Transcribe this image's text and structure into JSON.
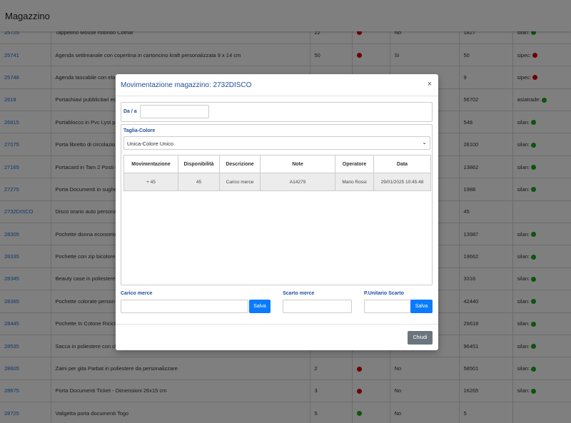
{
  "app": {
    "title": "Magazzino"
  },
  "background_rows": [
    {
      "code": "25725",
      "desc": "Tappetino Mouse rotondo Cotnar",
      "qty": "22",
      "dot": "red",
      "flag": "No",
      "stock": "1827",
      "supplier": "silan:",
      "sdot": "green"
    },
    {
      "code": "25741",
      "desc": "Agenda settimanale con copertina in cartoncino kraft personalizzata 9 x 14 cm",
      "qty": "50",
      "dot": "red",
      "flag": "Si",
      "stock": "50",
      "supplier": "sipec:",
      "sdot": "red"
    },
    {
      "code": "25748",
      "desc": "Agenda tascabile con ela",
      "qty": "",
      "dot": "",
      "flag": "",
      "stock": "9",
      "supplier": "sipec:",
      "sdot": "red"
    },
    {
      "code": "2618",
      "desc": "Portachiavi pubblicitari ec",
      "qty": "",
      "dot": "",
      "flag": "",
      "stock": "56702",
      "supplier": "asiatrade:",
      "sdot": "green"
    },
    {
      "code": "26615",
      "desc": "Portablocco in Pvc Lyst pe",
      "qty": "",
      "dot": "",
      "flag": "",
      "stock": "548",
      "supplier": "silan:",
      "sdot": "green"
    },
    {
      "code": "27075",
      "desc": "Porta libretto di circolazio",
      "qty": "",
      "dot": "",
      "flag": "",
      "stock": "28100",
      "supplier": "silan:",
      "sdot": "green"
    },
    {
      "code": "27165",
      "desc": "Portacard in Tam 2 Posti B",
      "qty": "",
      "dot": "",
      "flag": "",
      "stock": "13862",
      "supplier": "silan:",
      "sdot": "green"
    },
    {
      "code": "27275",
      "desc": "Porta Documenti in sughe",
      "qty": "",
      "dot": "",
      "flag": "",
      "stock": "1988",
      "supplier": "silan:",
      "sdot": "green"
    },
    {
      "code": "2732DISCO",
      "desc": "Disco orario auto persona",
      "qty": "",
      "dot": "",
      "flag": "",
      "stock": "45",
      "supplier": "",
      "sdot": ""
    },
    {
      "code": "28305",
      "desc": "Pochette donna economic",
      "qty": "",
      "dot": "",
      "flag": "",
      "stock": "13987",
      "supplier": "silan:",
      "sdot": "green"
    },
    {
      "code": "28335",
      "desc": "Pochette con zip bicolore",
      "qty": "",
      "dot": "",
      "flag": "",
      "stock": "19662",
      "supplier": "silan:",
      "sdot": "green"
    },
    {
      "code": "28345",
      "desc": "Beauty case in poliestere",
      "qty": "",
      "dot": "",
      "flag": "",
      "stock": "3316",
      "supplier": "silan:",
      "sdot": "green"
    },
    {
      "code": "28365",
      "desc": "Pochette colorate person",
      "qty": "",
      "dot": "",
      "flag": "",
      "stock": "42440",
      "supplier": "silan:",
      "sdot": "green"
    },
    {
      "code": "28445",
      "desc": "Pochette In Cotone Ricicl",
      "qty": "",
      "dot": "",
      "flag": "",
      "stock": "26618",
      "supplier": "silan:",
      "sdot": "green"
    },
    {
      "code": "28535",
      "desc": "Sacca in poliestere con ch",
      "qty": "",
      "dot": "",
      "flag": "",
      "stock": "96451",
      "supplier": "silan:",
      "sdot": "green"
    },
    {
      "code": "28605",
      "desc": "Zaini per gita Parbat in poliestere da personalizzare",
      "qty": "2",
      "dot": "red",
      "flag": "No",
      "stock": "58501",
      "supplier": "silan:",
      "sdot": "green"
    },
    {
      "code": "28675",
      "desc": "Porta Documenti Ticket - Dimensioni 26x15 cm",
      "qty": "3",
      "dot": "red",
      "flag": "No",
      "stock": "16265",
      "supplier": "silan:",
      "sdot": "green"
    },
    {
      "code": "28725",
      "desc": "Valigetta porta documenti Togo",
      "qty": "5",
      "dot": "green",
      "flag": "No",
      "stock": "5",
      "supplier": "",
      "sdot": ""
    }
  ],
  "modal": {
    "title": "Movimentazione magazzino: 2732DISCO",
    "close_glyph": "×",
    "da_a_label": "Da / a",
    "da_a_value": "",
    "taglia_label": "Taglia-Colore",
    "taglia_selected": "Unica-Colore Unico",
    "chevron_glyph": "⌄",
    "table": {
      "headers": [
        "Movimentazione",
        "Disponibilità",
        "Descrizione",
        "Note",
        "Operatore",
        "Data"
      ],
      "rows": [
        [
          "+ 45",
          "45",
          "Carico merce",
          "A14279",
          "Mario Rossi",
          "29/01/2025 10:45:48"
        ]
      ]
    },
    "carico_label": "Carico merce",
    "carico_value": "",
    "scarto_label": "Scarto merce",
    "scarto_value": "",
    "punitario_label": "P.Unitario Scarto",
    "punitario_value": "",
    "salva_label": "Salva",
    "chiudi_label": "Chiudi"
  },
  "colors": {
    "accent": "#0a7bff",
    "title_blue": "#1f4e9c",
    "secondary": "#6c757d",
    "status_red": "#dd0000",
    "status_green": "#1aa81a"
  }
}
